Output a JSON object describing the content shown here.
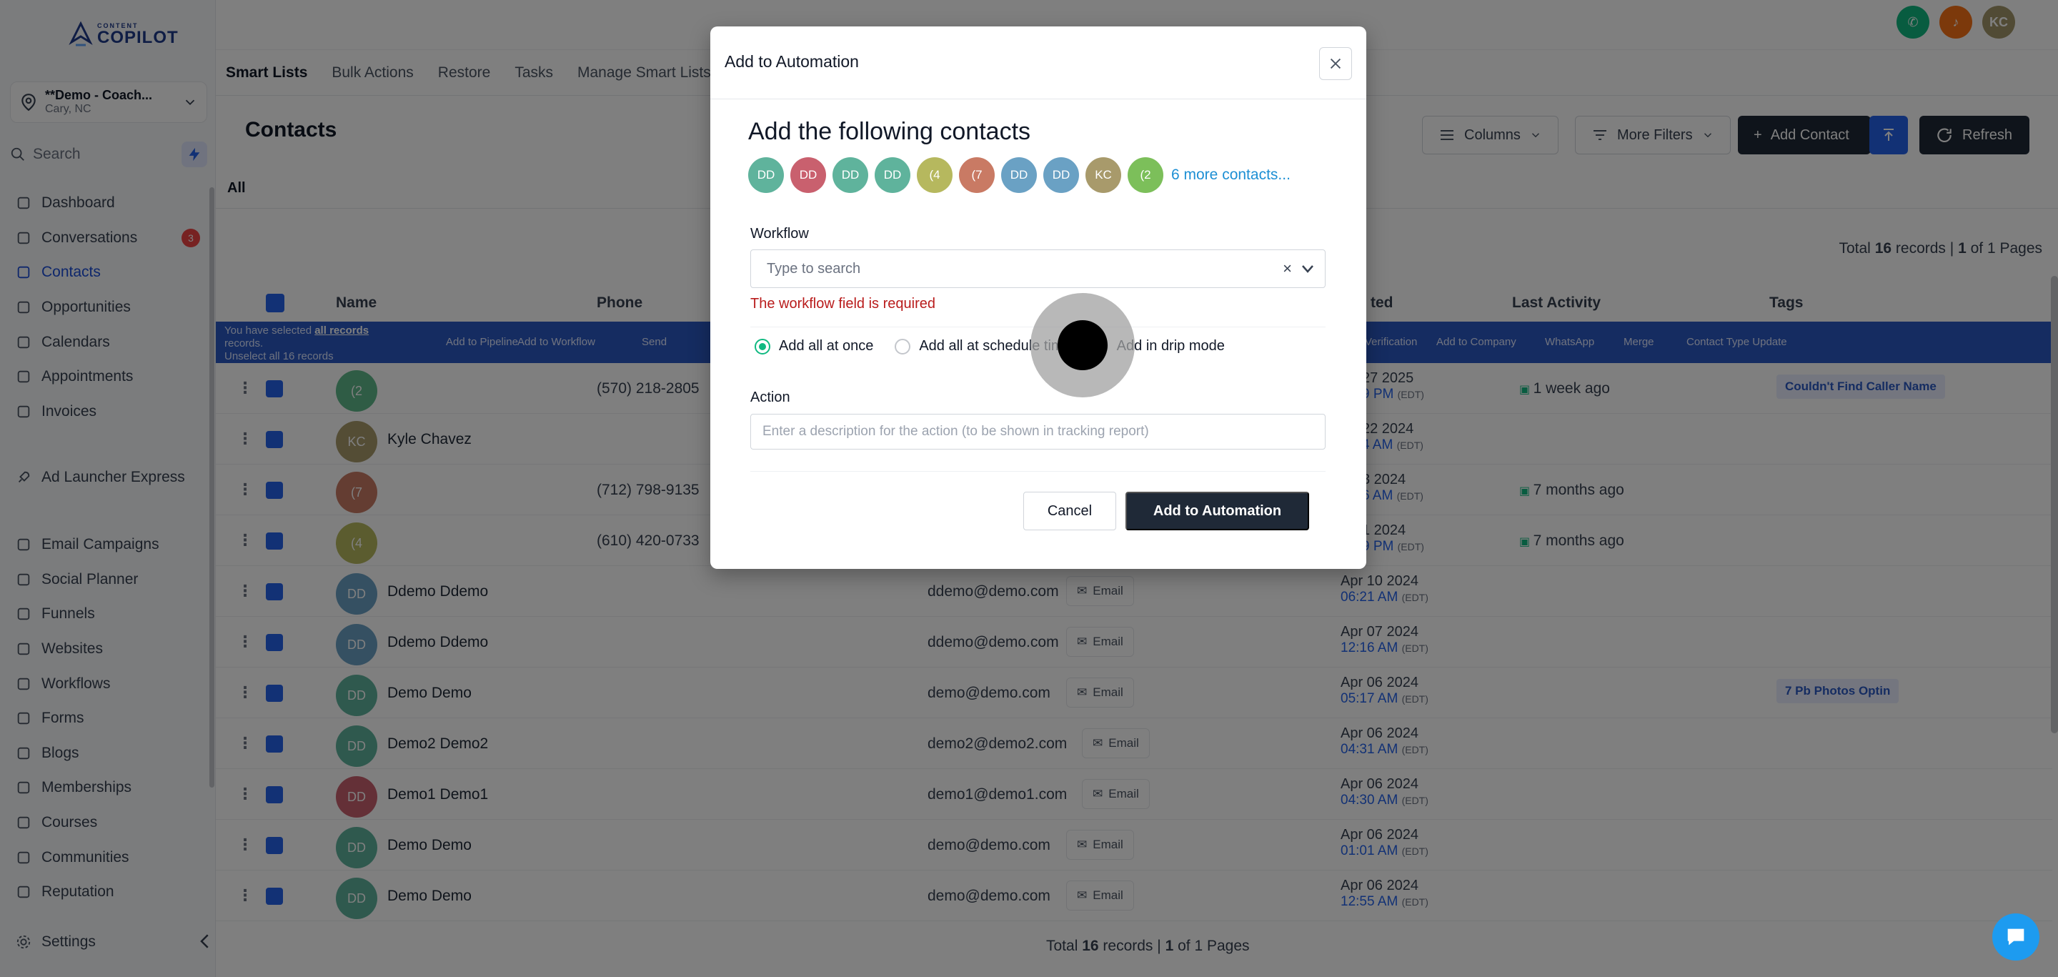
{
  "sidebar": {
    "logo_small": "CONTENT",
    "logo_big": "COPILOT",
    "location_name": "**Demo - Coach...",
    "location_sub": "Cary, NC",
    "search_label": "Search",
    "nav_primary": [
      {
        "label": "Dashboard",
        "icon": "dashboard-icon"
      },
      {
        "label": "Conversations",
        "icon": "chat-icon",
        "badge": "3"
      },
      {
        "label": "Contacts",
        "icon": "user-icon",
        "active": true
      },
      {
        "label": "Opportunities",
        "icon": "funnel-icon"
      },
      {
        "label": "Calendars",
        "icon": "calendar-icon"
      },
      {
        "label": "Appointments",
        "icon": "list-icon"
      },
      {
        "label": "Invoices",
        "icon": "invoice-icon"
      }
    ],
    "nav_launcher": "Ad Launcher Express",
    "nav_secondary": [
      {
        "label": "Email Campaigns",
        "icon": "send-icon"
      },
      {
        "label": "Social Planner",
        "icon": "grid-icon"
      },
      {
        "label": "Funnels",
        "icon": "funnel-icon"
      },
      {
        "label": "Websites",
        "icon": "monitor-icon"
      },
      {
        "label": "Workflows",
        "icon": "workflow-icon"
      },
      {
        "label": "Forms",
        "icon": "form-icon"
      },
      {
        "label": "Blogs",
        "icon": "blog-icon"
      },
      {
        "label": "Memberships",
        "icon": "membership-icon"
      },
      {
        "label": "Courses",
        "icon": "book-icon"
      },
      {
        "label": "Communities",
        "icon": "communities-icon"
      },
      {
        "label": "Reputation",
        "icon": "star-icon"
      }
    ],
    "settings_label": "Settings"
  },
  "topbar": {
    "avatars": [
      {
        "label": "",
        "color": "#10b981",
        "icon": "phone-icon"
      },
      {
        "label": "",
        "color": "#f97316",
        "icon": "bell-icon"
      },
      {
        "label": "KC",
        "color": "#a3966a"
      }
    ]
  },
  "tabs": [
    "Smart Lists",
    "Bulk Actions",
    "Restore",
    "Tasks",
    "Manage Smart Lists"
  ],
  "page": {
    "title": "Contacts",
    "columns_btn": "Columns",
    "filters_btn": "More Filters",
    "add_contact_btn": "Add Contact",
    "refresh_btn": "Refresh",
    "all_tab": "All",
    "total_prefix": "Total",
    "total_count": "16",
    "total_mid": "records |",
    "page_cur": "1",
    "page_suffix": "of 1 Pages"
  },
  "table": {
    "headers": {
      "name": "Name",
      "phone": "Phone",
      "created": "ted",
      "last_activity": "Last Activity",
      "tags": "Tags"
    },
    "selection": {
      "line1a": "You have selected",
      "line1b": "all records",
      "line2": "records.",
      "line3": "Unselect all 16 records",
      "actions": [
        "Add to Pipeline",
        "Add to Workflow",
        "Send",
        "Verification",
        "Add to Company",
        "WhatsApp",
        "Merge",
        "Contact Type Update"
      ]
    },
    "rows": [
      {
        "initials": "(2",
        "color": "#5fb98a",
        "name": "",
        "phone": "(570) 218-2805",
        "email": "",
        "date": "27 2025",
        "time": "9 PM",
        "last": "1 week ago",
        "tag": "Couldn't Find Caller Name"
      },
      {
        "initials": "KC",
        "color": "#a89a6b",
        "name": "Kyle Chavez",
        "phone": "",
        "email": "",
        "date": "22 2024",
        "time": "4 AM",
        "last": "",
        "tag": ""
      },
      {
        "initials": "(7",
        "color": "#c97a64",
        "name": "",
        "phone": "(712) 798-9135",
        "email": "",
        "date": "3 2024",
        "time": "6 AM",
        "last": "7 months ago",
        "tag": ""
      },
      {
        "initials": "(4",
        "color": "#b6b85e",
        "name": "",
        "phone": "(610) 420-0733",
        "email": "",
        "date": "1 2024",
        "time": "9 PM",
        "last": "7 months ago",
        "tag": ""
      },
      {
        "initials": "DD",
        "color": "#6aa1c4",
        "name": "Ddemo Ddemo",
        "phone": "",
        "email": "ddemo@demo.com",
        "date": "Apr 10 2024",
        "time": "06:21 AM",
        "last": "",
        "tag": ""
      },
      {
        "initials": "DD",
        "color": "#6aa1c4",
        "name": "Ddemo Ddemo",
        "phone": "",
        "email": "ddemo@demo.com",
        "date": "Apr 07 2024",
        "time": "12:16 AM",
        "last": "",
        "tag": ""
      },
      {
        "initials": "DD",
        "color": "#5fb39c",
        "name": "Demo Demo",
        "phone": "",
        "email": "demo@demo.com",
        "date": "Apr 06 2024",
        "time": "05:17 AM",
        "last": "",
        "tag": "7 Pb Photos Optin"
      },
      {
        "initials": "DD",
        "color": "#5fb39c",
        "name": "Demo2 Demo2",
        "phone": "",
        "email": "demo2@demo2.com",
        "date": "Apr 06 2024",
        "time": "04:31 AM",
        "last": "",
        "tag": ""
      },
      {
        "initials": "DD",
        "color": "#c9606e",
        "name": "Demo1 Demo1",
        "phone": "",
        "email": "demo1@demo1.com",
        "date": "Apr 06 2024",
        "time": "04:30 AM",
        "last": "",
        "tag": ""
      },
      {
        "initials": "DD",
        "color": "#5fb39c",
        "name": "Demo Demo",
        "phone": "",
        "email": "demo@demo.com",
        "date": "Apr 06 2024",
        "time": "01:01 AM",
        "last": "",
        "tag": ""
      },
      {
        "initials": "DD",
        "color": "#5fb39c",
        "name": "Demo Demo",
        "phone": "",
        "email": "demo@demo.com",
        "date": "Apr 06 2024",
        "time": "12:55 AM",
        "last": "",
        "tag": ""
      }
    ],
    "email_btn": "Email",
    "tz": "(EDT)"
  },
  "modal": {
    "title": "Add to Automation",
    "heading": "Add the following contacts",
    "chips": [
      {
        "label": "DD",
        "color": "#5fb39c"
      },
      {
        "label": "DD",
        "color": "#c9606e"
      },
      {
        "label": "DD",
        "color": "#5fb39c"
      },
      {
        "label": "DD",
        "color": "#5fb39c"
      },
      {
        "label": "(4",
        "color": "#b6b85e"
      },
      {
        "label": "(7",
        "color": "#c97a64"
      },
      {
        "label": "DD",
        "color": "#6aa1c4"
      },
      {
        "label": "DD",
        "color": "#6aa1c4"
      },
      {
        "label": "KC",
        "color": "#a89a6b"
      },
      {
        "label": "(2",
        "color": "#7cbf5a"
      }
    ],
    "more_link": "6 more contacts...",
    "workflow_label": "Workflow",
    "workflow_placeholder": "Type to search",
    "workflow_error": "The workflow field is required",
    "radio_options": [
      "Add all at once",
      "Add all at schedule time",
      "Add in drip mode"
    ],
    "action_label": "Action",
    "action_placeholder": "Enter a description for the action (to be shown in tracking report)",
    "cancel": "Cancel",
    "submit": "Add to Automation"
  }
}
